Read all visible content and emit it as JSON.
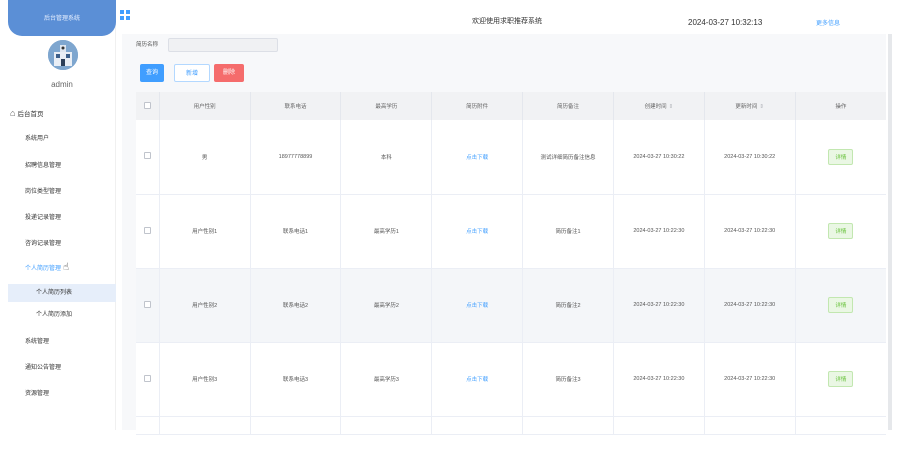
{
  "brand": {
    "title": "后台管理系统"
  },
  "user": {
    "name": "admin"
  },
  "menu": {
    "home": "后台首页",
    "items": [
      "系统用户",
      "招聘信息管理",
      "岗位类型管理",
      "投递记录管理",
      "咨询记录管理"
    ],
    "active": "个人简历管理",
    "sub": [
      "个人简历列表",
      "个人简历添加"
    ],
    "items2": [
      "系统管理",
      "通知公告管理",
      "资源管理"
    ]
  },
  "header": {
    "welcome": "欢迎使用求职推荐系统",
    "datetime": "2024-03-27 10:32:13",
    "more": "更多信息"
  },
  "search": {
    "label": "简历名称",
    "placeholder": ""
  },
  "buttons": {
    "query": "查询",
    "add": "新增",
    "delete": "删除"
  },
  "table": {
    "headers": [
      "用户性别",
      "联系电话",
      "最高学历",
      "简历附件",
      "简历备注",
      "创建时间",
      "更新时间",
      "操作"
    ],
    "rows": [
      [
        "男",
        "18977778899",
        "本科",
        "点击下载",
        "测试详细简历备注信息",
        "2024-03-27 10:30:22",
        "2024-03-27 10:30:22",
        "详情"
      ],
      [
        "用户性别1",
        "联系电话1",
        "最高学历1",
        "点击下载",
        "简历备注1",
        "2024-03-27 10:22:30",
        "2024-03-27 10:22:30",
        "详情"
      ],
      [
        "用户性别2",
        "联系电话2",
        "最高学历2",
        "点击下载",
        "简历备注2",
        "2024-03-27 10:22:30",
        "2024-03-27 10:22:30",
        "详情"
      ],
      [
        "用户性别3",
        "联系电话3",
        "最高学历3",
        "点击下载",
        "简历备注3",
        "2024-03-27 10:22:30",
        "2024-03-27 10:22:30",
        "详情"
      ]
    ]
  },
  "colors": {
    "primary": "#409eff",
    "danger": "#f56c6c",
    "success": "#67c23a",
    "brand": "#5b8fd6"
  }
}
